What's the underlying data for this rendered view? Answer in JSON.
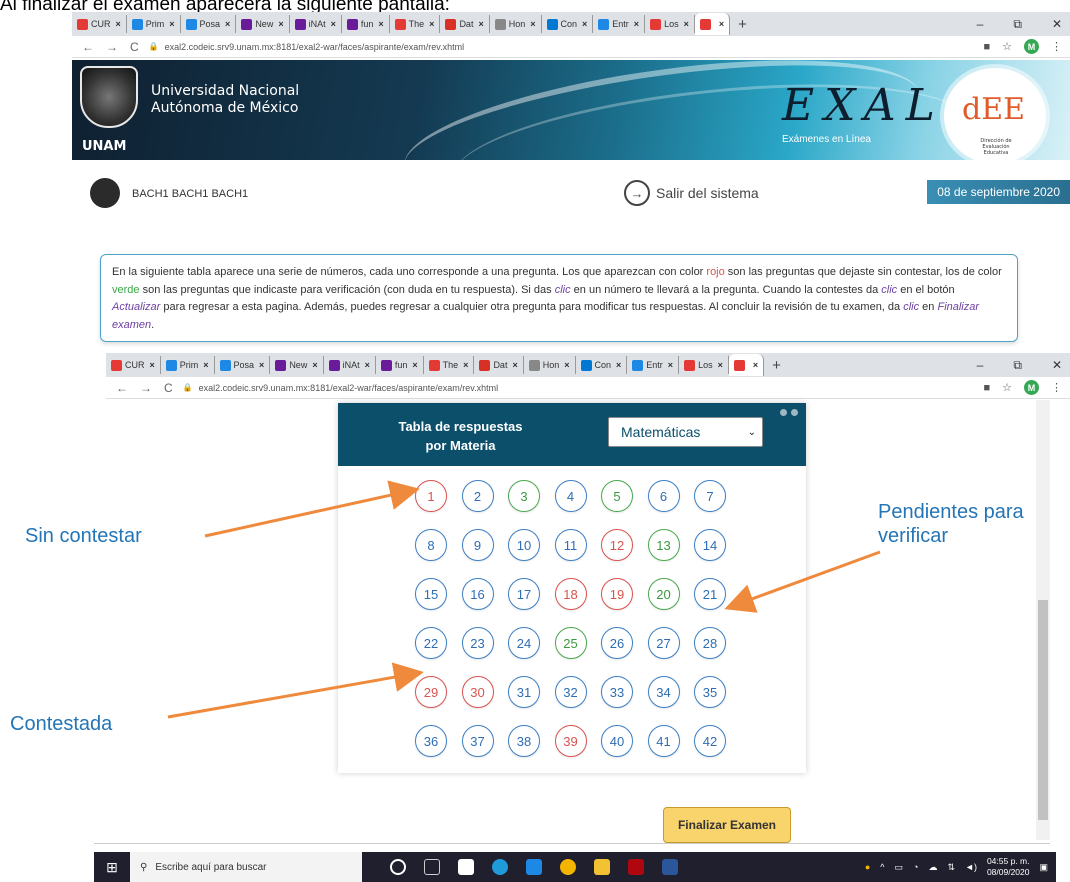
{
  "caption": "Al finalizar el examen aparecerá la siguiente pantalla:",
  "browser": {
    "tabs": [
      {
        "label": "CUR",
        "color": "#e53935"
      },
      {
        "label": "Prim",
        "color": "#1e88e5"
      },
      {
        "label": "Posa",
        "color": "#1e88e5"
      },
      {
        "label": "New",
        "color": "#6a1b9a"
      },
      {
        "label": "iNAt",
        "color": "#6a1b9a"
      },
      {
        "label": "fun",
        "color": "#6a1b9a"
      },
      {
        "label": "The",
        "color": "#e53935"
      },
      {
        "label": "Dat",
        "color": "#d93025"
      },
      {
        "label": "Hon",
        "color": "#888888"
      },
      {
        "label": "Con",
        "color": "#0078d4"
      },
      {
        "label": "Entr",
        "color": "#1e88e5"
      },
      {
        "label": "Los",
        "color": "#e53935"
      },
      {
        "label": "",
        "color": "#e53935",
        "active": true
      }
    ],
    "url": "exal2.codeic.srv9.unam.mx:8181/exal2-war/faces/aspirante/exam/rev.xhtml",
    "profile_initial": "M"
  },
  "header": {
    "university_line1": "Universidad Nacional",
    "university_line2": "Autónoma de México",
    "unam": "UNAM",
    "exal": "EXAL",
    "exal_sub": "Exámenes en Línea",
    "dee": "dEE",
    "dee_sub": "Dirección de Evaluación Educativa"
  },
  "user": {
    "name": "BACH1 BACH1 BACH1",
    "logout": "Salir del sistema",
    "date": "08 de septiembre 2020"
  },
  "info": {
    "p1": "En la siguiente tabla aparece una serie de números, cada uno corresponde a una pregunta. Los que aparezcan con color ",
    "red": "rojo",
    "p2": " son las preguntas que dejaste sin contestar, los de color ",
    "green": "verde",
    "p3": " son las preguntas que indicaste para verificación (con duda en tu respuesta). Si das ",
    "clic1": "clic",
    "p4": " en un número te llevará a la pregunta. Cuando la contestes da ",
    "clic2": "clic",
    "p5": " en el botón ",
    "actualizar": "Actualizar",
    "p6": " para regresar a esta pagina. Además, puedes regresar a cualquier otra pregunta para modificar tus respuestas. Al concluir la revisión de tu examen, da ",
    "clic3": "clic",
    "p7": " en ",
    "finalizar": "Finalizar examen",
    "p8": "."
  },
  "panel": {
    "title_line1": "Tabla de respuestas",
    "title_line2": "por Materia",
    "subject": "Matemáticas",
    "questions": [
      {
        "n": "1",
        "s": "red"
      },
      {
        "n": "2",
        "s": "blue"
      },
      {
        "n": "3",
        "s": "green"
      },
      {
        "n": "4",
        "s": "blue"
      },
      {
        "n": "5",
        "s": "green"
      },
      {
        "n": "6",
        "s": "blue"
      },
      {
        "n": "7",
        "s": "blue"
      },
      {
        "n": "8",
        "s": "blue"
      },
      {
        "n": "9",
        "s": "blue"
      },
      {
        "n": "10",
        "s": "blue"
      },
      {
        "n": "11",
        "s": "blue"
      },
      {
        "n": "12",
        "s": "red"
      },
      {
        "n": "13",
        "s": "green"
      },
      {
        "n": "14",
        "s": "blue"
      },
      {
        "n": "15",
        "s": "blue"
      },
      {
        "n": "16",
        "s": "blue"
      },
      {
        "n": "17",
        "s": "blue"
      },
      {
        "n": "18",
        "s": "red"
      },
      {
        "n": "19",
        "s": "red"
      },
      {
        "n": "20",
        "s": "green"
      },
      {
        "n": "21",
        "s": "blue"
      },
      {
        "n": "22",
        "s": "blue"
      },
      {
        "n": "23",
        "s": "blue"
      },
      {
        "n": "24",
        "s": "blue"
      },
      {
        "n": "25",
        "s": "green"
      },
      {
        "n": "26",
        "s": "blue"
      },
      {
        "n": "27",
        "s": "blue"
      },
      {
        "n": "28",
        "s": "blue"
      },
      {
        "n": "29",
        "s": "red"
      },
      {
        "n": "30",
        "s": "red"
      },
      {
        "n": "31",
        "s": "blue"
      },
      {
        "n": "32",
        "s": "blue"
      },
      {
        "n": "33",
        "s": "blue"
      },
      {
        "n": "34",
        "s": "blue"
      },
      {
        "n": "35",
        "s": "blue"
      },
      {
        "n": "36",
        "s": "blue"
      },
      {
        "n": "37",
        "s": "blue"
      },
      {
        "n": "38",
        "s": "blue"
      },
      {
        "n": "39",
        "s": "red"
      },
      {
        "n": "40",
        "s": "blue"
      },
      {
        "n": "41",
        "s": "blue"
      },
      {
        "n": "42",
        "s": "blue"
      }
    ],
    "finalize_button": "Finalizar Examen"
  },
  "annotations": {
    "unanswered": "Sin contestar",
    "pending_line1": "Pendientes para",
    "pending_line2": "verificar",
    "answered": "Contestada"
  },
  "taskbar": {
    "search_placeholder": "Escribe aquí para buscar",
    "time": "04:55 p. m.",
    "date": "08/09/2020"
  },
  "colors": {
    "red": "#d9534f",
    "green": "#3a9a40",
    "blue": "#2e6db4",
    "arrow": "#ef8a3c",
    "annotation_text": "#2475b6"
  }
}
